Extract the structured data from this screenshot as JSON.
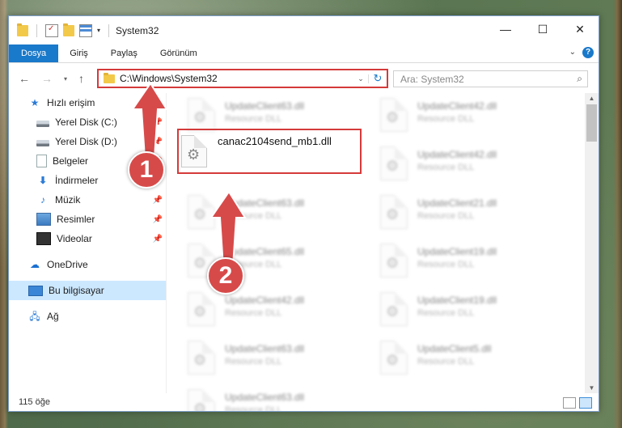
{
  "window": {
    "title": "System32"
  },
  "ribbon": {
    "tabs": [
      "Dosya",
      "Giriş",
      "Paylaş",
      "Görünüm"
    ],
    "help": "?"
  },
  "window_controls": {
    "minimize": "—",
    "maximize": "☐",
    "close": "✕"
  },
  "address": {
    "path": "C:\\Windows\\System32"
  },
  "search": {
    "placeholder": "Ara: System32"
  },
  "sidebar": {
    "quick_access": "Hızlı erişim",
    "items": [
      {
        "label": "Yerel Disk (C:)",
        "pinned": true
      },
      {
        "label": "Yerel Disk (D:)",
        "pinned": true
      },
      {
        "label": "Belgeler",
        "pinned": true
      },
      {
        "label": "İndirmeler",
        "pinned": true
      },
      {
        "label": "Müzik",
        "pinned": true
      },
      {
        "label": "Resimler",
        "pinned": true
      },
      {
        "label": "Videolar",
        "pinned": true
      }
    ],
    "onedrive": "OneDrive",
    "this_pc": "Bu bilgisayar",
    "network": "Ağ"
  },
  "files": {
    "left": [
      {
        "name": "UpdateClient63.dll",
        "type": "Resource DLL"
      },
      {
        "name": "canac2104send_mb1.dll",
        "type": ""
      },
      {
        "name": "UpdateClient63.dll",
        "type": "Resource DLL"
      },
      {
        "name": "UpdateClient65.dll",
        "type": "Resource DLL"
      },
      {
        "name": "UpdateClient42.dll",
        "type": "Resource DLL"
      },
      {
        "name": "UpdateClient63.dll",
        "type": "Resource DLL"
      },
      {
        "name": "UpdateClient63.dll",
        "type": "Resource DLL"
      }
    ],
    "right": [
      {
        "name": "UpdateClient42.dll",
        "type": "Resource DLL"
      },
      {
        "name": "UpdateClient42.dll",
        "type": "Resource DLL"
      },
      {
        "name": "UpdateClient21.dll",
        "type": "Resource DLL"
      },
      {
        "name": "UpdateClient19.dll",
        "type": "Resource DLL"
      },
      {
        "name": "UpdateClient19.dll",
        "type": "Resource DLL"
      },
      {
        "name": "UpdateClient5.dll",
        "type": "Resource DLL"
      }
    ]
  },
  "status": {
    "count": "115 öğe"
  },
  "callouts": [
    "1",
    "2"
  ]
}
